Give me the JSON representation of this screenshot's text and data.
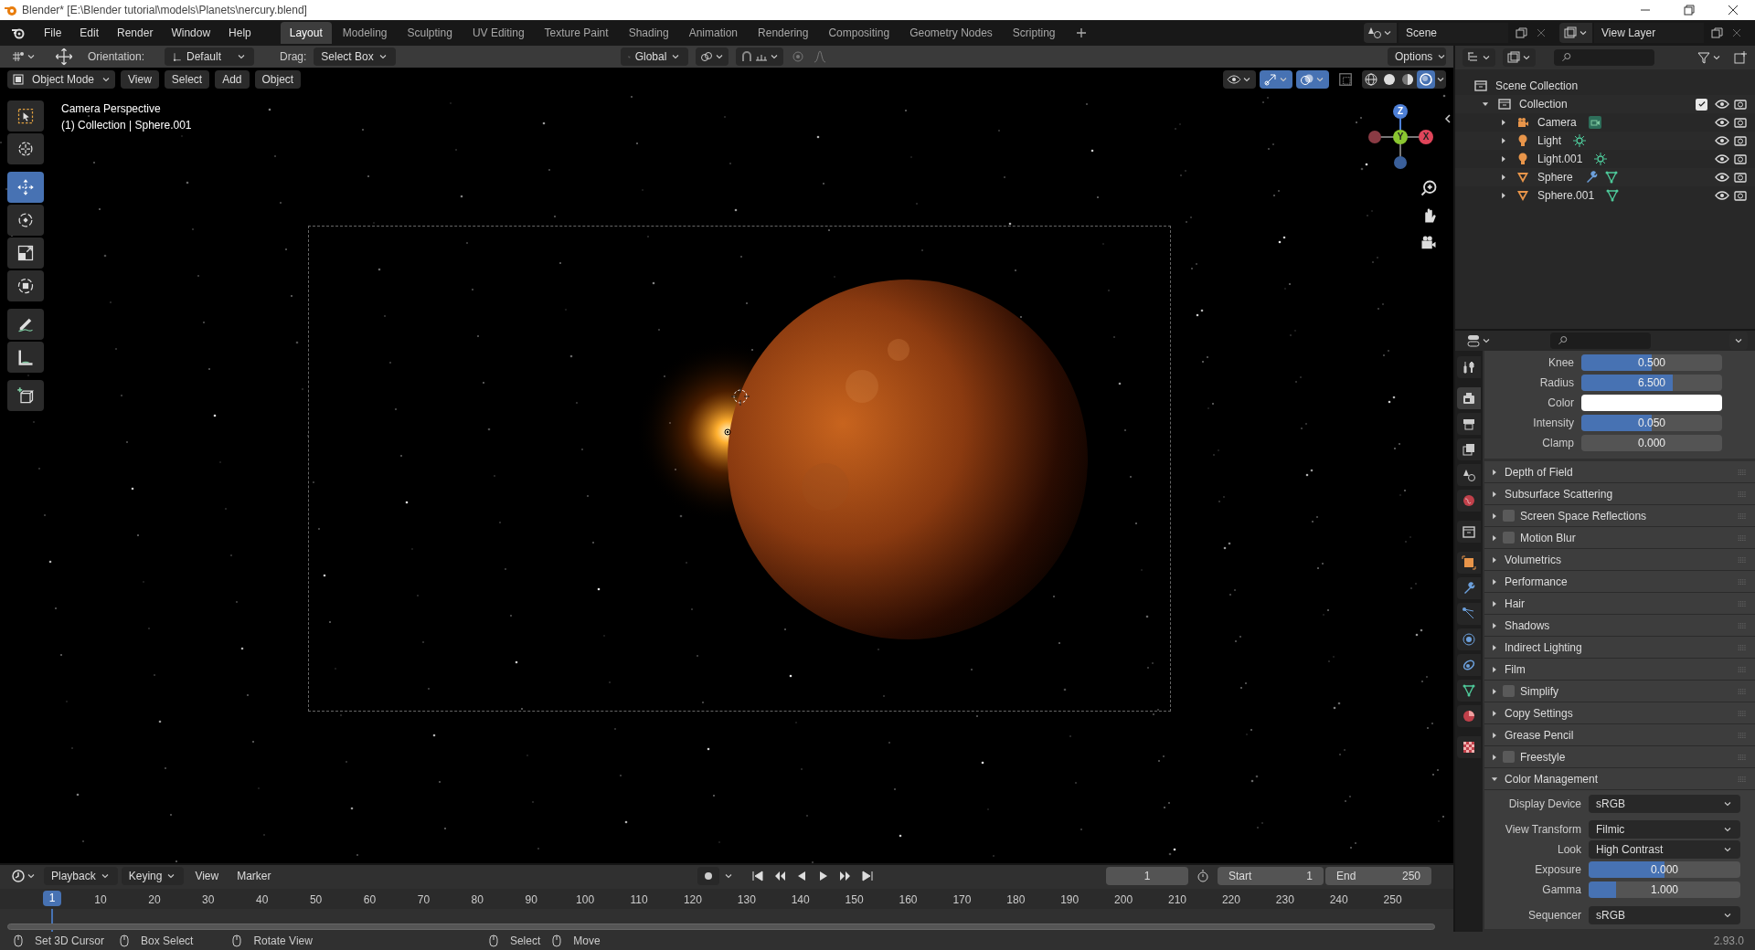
{
  "title_bar": {
    "title": "Blender* [E:\\Blender tutorial\\models\\Planets\\nercury.blend]"
  },
  "menu": [
    "File",
    "Edit",
    "Render",
    "Window",
    "Help"
  ],
  "workspace_tabs": [
    {
      "label": "Layout",
      "selected": true
    },
    {
      "label": "Modeling",
      "selected": false
    },
    {
      "label": "Sculpting",
      "selected": false
    },
    {
      "label": "UV Editing",
      "selected": false
    },
    {
      "label": "Texture Paint",
      "selected": false
    },
    {
      "label": "Shading",
      "selected": false
    },
    {
      "label": "Animation",
      "selected": false
    },
    {
      "label": "Rendering",
      "selected": false
    },
    {
      "label": "Compositing",
      "selected": false
    },
    {
      "label": "Geometry Nodes",
      "selected": false
    },
    {
      "label": "Scripting",
      "selected": false
    }
  ],
  "scene": "Scene",
  "view_layer": "View Layer",
  "tool_header": {
    "orientation_label": "Orientation:",
    "orientation": "Default",
    "drag_label": "Drag:",
    "drag": "Select Box",
    "transform": "Global",
    "options": "Options"
  },
  "viewport_header": {
    "mode": "Object Mode",
    "menus": [
      "View",
      "Select",
      "Add",
      "Object"
    ],
    "shading_modes": [
      {
        "kind": "wireframe",
        "selected": false
      },
      {
        "kind": "solid",
        "selected": false
      },
      {
        "kind": "material",
        "selected": false
      },
      {
        "kind": "rendered",
        "selected": true
      }
    ]
  },
  "viewport": {
    "view_name": "Camera Perspective",
    "collection_info": "(1) Collection | Sphere.001",
    "gizmo": {
      "z": "Z",
      "y": "Y",
      "x": "X"
    }
  },
  "toolbar": [
    {
      "kind": "select_box",
      "selected": false
    },
    {
      "kind": "cursor",
      "selected": false
    },
    {
      "kind": "move",
      "selected": true
    },
    {
      "kind": "rotate",
      "selected": false
    },
    {
      "kind": "scale",
      "selected": false
    },
    {
      "kind": "transform",
      "selected": false
    },
    {
      "kind": "annotate",
      "selected": false
    },
    {
      "kind": "measure",
      "selected": false
    },
    {
      "kind": "add_cube",
      "selected": false
    }
  ],
  "outliner": {
    "root": "Scene Collection",
    "children": [
      {
        "label": "Collection",
        "expanded": true,
        "checked": true,
        "children": [
          {
            "label": "Camera",
            "kind": "camera",
            "expanded": false,
            "extras": [
              {
                "kind": "camera_data"
              }
            ]
          },
          {
            "label": "Light",
            "kind": "light",
            "expanded": false,
            "extras": [
              {
                "kind": "light_data"
              }
            ]
          },
          {
            "label": "Light.001",
            "kind": "light",
            "expanded": false,
            "extras": [
              {
                "kind": "light_data"
              }
            ]
          },
          {
            "label": "Sphere",
            "kind": "mesh",
            "expanded": false,
            "extras": [
              {
                "kind": "modifier"
              },
              {
                "kind": "mesh_data"
              }
            ]
          },
          {
            "label": "Sphere.001",
            "kind": "mesh",
            "expanded": false,
            "extras": [
              {
                "kind": "mesh_data"
              }
            ]
          }
        ]
      }
    ]
  },
  "properties": {
    "tabs": [
      {
        "kind": "tool",
        "selected": false
      },
      {
        "kind": "render",
        "selected": true
      },
      {
        "kind": "output",
        "selected": false
      },
      {
        "kind": "view_layer",
        "selected": false
      },
      {
        "kind": "scene",
        "selected": false
      },
      {
        "kind": "world",
        "selected": false
      },
      {
        "kind": "collection",
        "selected": false
      },
      {
        "kind": "object",
        "selected": false
      },
      {
        "kind": "modifier",
        "selected": false
      },
      {
        "kind": "particles",
        "selected": false
      },
      {
        "kind": "physics",
        "selected": false
      },
      {
        "kind": "constraints",
        "selected": false
      },
      {
        "kind": "data",
        "selected": false
      },
      {
        "kind": "material",
        "selected": false
      },
      {
        "kind": "texture",
        "selected": false
      }
    ],
    "fields": [
      {
        "label": "Knee",
        "kind": "slider",
        "value": "0.500",
        "level": 0.5
      },
      {
        "label": "Radius",
        "kind": "slider",
        "value": "6.500",
        "level": 0.65
      },
      {
        "label": "Color",
        "kind": "color",
        "color": "#ffffff"
      },
      {
        "label": "Intensity",
        "kind": "slider",
        "value": "0.050",
        "level": 0.5
      },
      {
        "label": "Clamp",
        "kind": "slider",
        "value": "0.000",
        "level": 0
      }
    ],
    "panels": [
      {
        "label": "Depth of Field",
        "kind": "panel",
        "expanded": false
      },
      {
        "label": "Subsurface Scattering",
        "kind": "panel",
        "expanded": false
      },
      {
        "label": "Screen Space Reflections",
        "kind": "checkbox_panel",
        "checked": false,
        "expanded": false
      },
      {
        "label": "Motion Blur",
        "kind": "checkbox_panel",
        "checked": false,
        "expanded": false
      },
      {
        "label": "Volumetrics",
        "kind": "panel",
        "expanded": false
      },
      {
        "label": "Performance",
        "kind": "panel",
        "expanded": false
      },
      {
        "label": "Hair",
        "kind": "panel",
        "expanded": false
      },
      {
        "label": "Shadows",
        "kind": "panel",
        "expanded": false
      },
      {
        "label": "Indirect Lighting",
        "kind": "panel",
        "expanded": false
      },
      {
        "label": "Film",
        "kind": "panel",
        "expanded": false
      },
      {
        "label": "Simplify",
        "kind": "checkbox_panel",
        "checked": false,
        "expanded": false
      },
      {
        "label": "Copy Settings",
        "kind": "panel",
        "expanded": false
      },
      {
        "label": "Grease Pencil",
        "kind": "panel",
        "expanded": false
      },
      {
        "label": "Freestyle",
        "kind": "checkbox_panel",
        "checked": false,
        "expanded": false
      },
      {
        "label": "Color Management",
        "kind": "panel",
        "expanded": true
      }
    ],
    "color_management": [
      {
        "label": "Display Device",
        "kind": "dropdown",
        "value": "sRGB"
      },
      {
        "label": "View Transform",
        "kind": "dropdown",
        "value": "Filmic"
      },
      {
        "label": "Look",
        "kind": "dropdown",
        "value": "High Contrast"
      },
      {
        "label": "Exposure",
        "kind": "slider",
        "value": "0.000",
        "level": 0.5
      },
      {
        "label": "Gamma",
        "kind": "slider",
        "value": "1.000",
        "level": 0.18
      },
      {
        "label": "Sequencer",
        "kind": "dropdown",
        "value": "sRGB"
      }
    ]
  },
  "timeline": {
    "menus": [
      {
        "label": "Playback",
        "dropdown": true
      },
      {
        "label": "Keying",
        "dropdown": true
      },
      {
        "label": "View",
        "dropdown": false
      },
      {
        "label": "Marker",
        "dropdown": false
      }
    ],
    "current_frame": "1",
    "start_label": "Start",
    "start": "1",
    "end_label": "End",
    "end": "250",
    "current_frame_marker": "1",
    "frame_labels": [
      "10",
      "20",
      "30",
      "40",
      "50",
      "60",
      "70",
      "80",
      "90",
      "100",
      "110",
      "120",
      "130",
      "140",
      "150",
      "160",
      "170",
      "180",
      "190",
      "200",
      "210",
      "220",
      "230",
      "240",
      "250"
    ]
  },
  "status_bar": {
    "hints": [
      {
        "label": "Set 3D Cursor"
      },
      {
        "label": "Box Select"
      },
      {
        "label": "Rotate View"
      },
      {
        "label": "Select"
      },
      {
        "label": "Move"
      }
    ],
    "version": "2.93.0"
  }
}
